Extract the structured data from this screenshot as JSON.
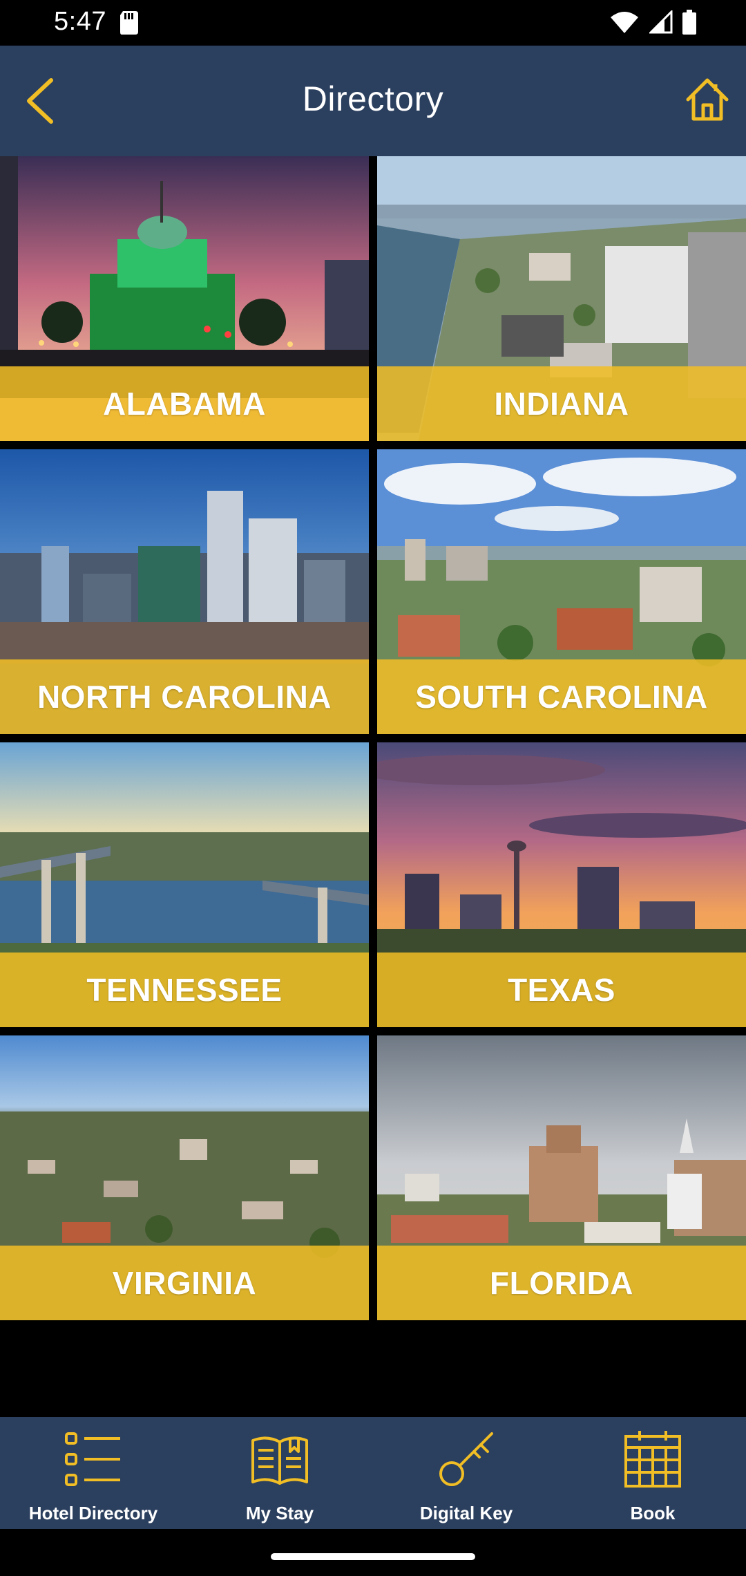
{
  "status": {
    "time": "5:47"
  },
  "header": {
    "title": "Directory"
  },
  "states": [
    {
      "label": "ALABAMA"
    },
    {
      "label": "INDIANA"
    },
    {
      "label": "NORTH CAROLINA"
    },
    {
      "label": "SOUTH CAROLINA"
    },
    {
      "label": "TENNESSEE"
    },
    {
      "label": "TEXAS"
    },
    {
      "label": "VIRGINIA"
    },
    {
      "label": "FLORIDA"
    }
  ],
  "nav": [
    {
      "label": "Hotel Directory",
      "icon": "list-icon"
    },
    {
      "label": "My Stay",
      "icon": "book-icon"
    },
    {
      "label": "Digital Key",
      "icon": "key-icon"
    },
    {
      "label": "Book",
      "icon": "calendar-icon"
    }
  ],
  "colors": {
    "header": "#2b3f5e",
    "accent": "#f1be25",
    "text": "#ffffff"
  }
}
